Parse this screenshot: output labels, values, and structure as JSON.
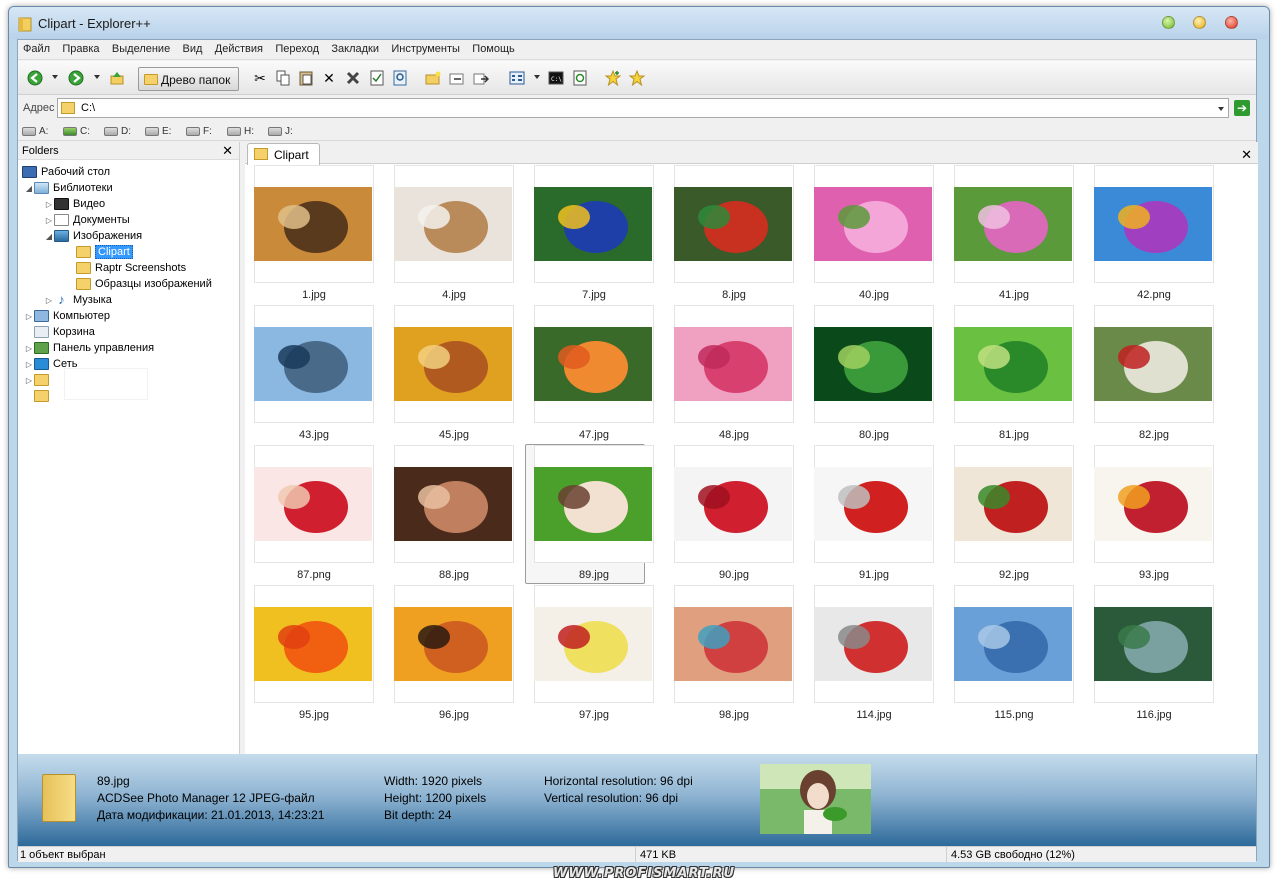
{
  "window": {
    "title": "Clipart - Explorer++"
  },
  "menu": [
    "Файл",
    "Правка",
    "Выделение",
    "Вид",
    "Действия",
    "Переход",
    "Закладки",
    "Инструменты",
    "Помощь"
  ],
  "toolbar": {
    "folder_tree_label": "Древо папок"
  },
  "address": {
    "label": "Адрес",
    "value": "C:\\"
  },
  "drives": [
    "A:",
    "C:",
    "D:",
    "E:",
    "F:",
    "H:",
    "J:"
  ],
  "folders_pane": {
    "title": "Folders",
    "items": [
      {
        "label": "Рабочий стол",
        "icon": "desktop-icon"
      },
      {
        "label": "Библиотеки",
        "icon": "library-icon"
      },
      {
        "label": "Видео",
        "icon": "video-icon"
      },
      {
        "label": "Документы",
        "icon": "document-icon"
      },
      {
        "label": "Изображения",
        "icon": "pictures-icon"
      },
      {
        "label": "Clipart",
        "icon": "folder-icon"
      },
      {
        "label": "Raptr Screenshots",
        "icon": "folder-icon"
      },
      {
        "label": "Образцы изображений",
        "icon": "folder-icon"
      },
      {
        "label": "Музыка",
        "icon": "music-icon"
      },
      {
        "label": "Компьютер",
        "icon": "computer-icon"
      },
      {
        "label": "Корзина",
        "icon": "recycle-bin-icon"
      },
      {
        "label": "Панель управления",
        "icon": "control-panel-icon"
      },
      {
        "label": "Сеть",
        "icon": "network-icon"
      }
    ]
  },
  "tab": {
    "label": "Clipart"
  },
  "files": [
    {
      "name": "1.jpg",
      "colors": [
        "#c98a3a",
        "#5a3a1c",
        "#e0c08a"
      ]
    },
    {
      "name": "4.jpg",
      "colors": [
        "#e9e3dc",
        "#b98a5a",
        "#f5f2ee"
      ]
    },
    {
      "name": "7.jpg",
      "colors": [
        "#2a6a2a",
        "#1e3fa8",
        "#f0c020"
      ]
    },
    {
      "name": "8.jpg",
      "colors": [
        "#3a5a2a",
        "#c83020",
        "#2e8a3a"
      ]
    },
    {
      "name": "40.jpg",
      "colors": [
        "#e060b0",
        "#f4a6d8",
        "#5a9a3a"
      ]
    },
    {
      "name": "41.jpg",
      "colors": [
        "#5a9a3a",
        "#d86ab8",
        "#f0c0e0"
      ]
    },
    {
      "name": "42.png",
      "colors": [
        "#3a8ad8",
        "#a040c0",
        "#f0b020"
      ]
    },
    {
      "name": "43.jpg",
      "colors": [
        "#8ab8e0",
        "#4a6a8a",
        "#1a3a5a"
      ]
    },
    {
      "name": "45.jpg",
      "colors": [
        "#e0a020",
        "#b05a20",
        "#f2d080"
      ]
    },
    {
      "name": "47.jpg",
      "colors": [
        "#3a6a2a",
        "#f08a30",
        "#e05a20"
      ]
    },
    {
      "name": "48.jpg",
      "colors": [
        "#f0a0c0",
        "#d84070",
        "#c02a5a"
      ]
    },
    {
      "name": "80.jpg",
      "colors": [
        "#0a4a1a",
        "#3a9a3a",
        "#a0d060"
      ]
    },
    {
      "name": "81.jpg",
      "colors": [
        "#6ac040",
        "#2a8a2a",
        "#c0e080"
      ]
    },
    {
      "name": "82.jpg",
      "colors": [
        "#6a8a4a",
        "#e0e0d0",
        "#c02020"
      ]
    },
    {
      "name": "87.png",
      "colors": [
        "#fbe6e6",
        "#d02030",
        "#f0c8b0"
      ]
    },
    {
      "name": "88.jpg",
      "colors": [
        "#4a2a1a",
        "#c08060",
        "#e8c0a0"
      ]
    },
    {
      "name": "89.jpg",
      "colors": [
        "#4aa02a",
        "#f2e0d0",
        "#6a4030"
      ]
    },
    {
      "name": "90.jpg",
      "colors": [
        "#f4f4f4",
        "#d02030",
        "#a01020"
      ]
    },
    {
      "name": "91.jpg",
      "colors": [
        "#f6f6f6",
        "#d02020",
        "#c0c0c0"
      ]
    },
    {
      "name": "92.jpg",
      "colors": [
        "#f0e6d8",
        "#c02020",
        "#3a8a2a"
      ]
    },
    {
      "name": "93.jpg",
      "colors": [
        "#f8f4ee",
        "#c02030",
        "#f0a020"
      ]
    },
    {
      "name": "95.jpg",
      "colors": [
        "#f0c020",
        "#f06010",
        "#e04010"
      ]
    },
    {
      "name": "96.jpg",
      "colors": [
        "#f0a020",
        "#d06020",
        "#2a1a10"
      ]
    },
    {
      "name": "97.jpg",
      "colors": [
        "#f4f0e8",
        "#f0e060",
        "#c02020"
      ]
    },
    {
      "name": "98.jpg",
      "colors": [
        "#e0a080",
        "#d04040",
        "#40a0c0"
      ]
    },
    {
      "name": "114.jpg",
      "colors": [
        "#e8e8e8",
        "#d03030",
        "#8a8a8a"
      ]
    },
    {
      "name": "115.png",
      "colors": [
        "#6aa0d8",
        "#3a70b0",
        "#a8c8e8"
      ]
    },
    {
      "name": "116.jpg",
      "colors": [
        "#2a5a3a",
        "#7aa0a0",
        "#3a7a4a"
      ]
    }
  ],
  "selected_file": "89.jpg",
  "details": {
    "filename": "89.jpg",
    "type": "ACDSee Photo Manager 12 JPEG-файл",
    "modified": "Дата модификации: 21.01.2013, 14:23:21",
    "width": "Width: 1920 pixels",
    "height": "Height: 1200 pixels",
    "bit_depth": "Bit depth: 24",
    "h_res": "Horizontal resolution: 96 dpi",
    "v_res": "Vertical resolution: 96 dpi"
  },
  "status": {
    "selection": "1 объект выбран",
    "size": "471 KB",
    "free": "4.53 GB свободно (12%)"
  },
  "watermark": "WWW.PROFISMART.RU"
}
